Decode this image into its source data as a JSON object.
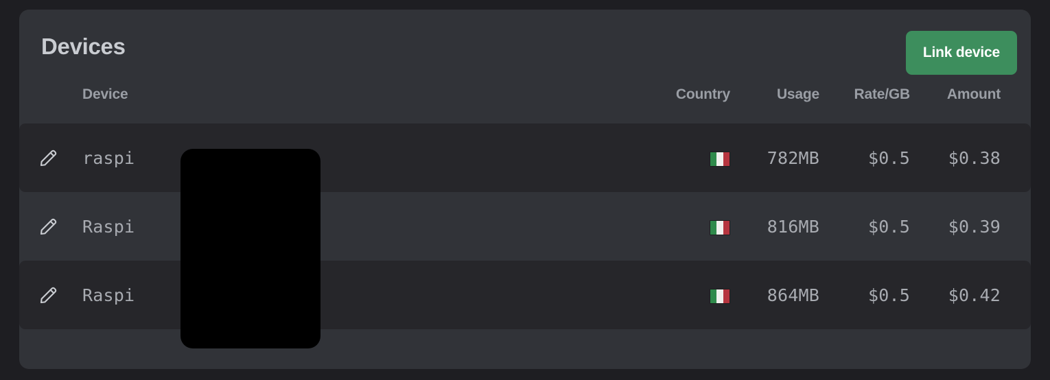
{
  "card": {
    "title": "Devices",
    "primary_action": {
      "label": "Link device",
      "color": "#3d8e5d",
      "text_color": "#ffffff"
    }
  },
  "table": {
    "columns": [
      {
        "key": "edit",
        "label": "",
        "icon": "pencil-icon"
      },
      {
        "key": "device",
        "label": "Device"
      },
      {
        "key": "country",
        "label": "Country"
      },
      {
        "key": "usage",
        "label": "Usage"
      },
      {
        "key": "rate",
        "label": "Rate/GB"
      },
      {
        "key": "amount",
        "label": "Amount"
      }
    ],
    "rows": [
      {
        "edit_icon": "pencil-icon",
        "device": "raspi",
        "country_flag": "flag-italy",
        "country_code": "IT",
        "usage": "782MB",
        "rate": "$0.5",
        "amount": "$0.38"
      },
      {
        "edit_icon": "pencil-icon",
        "device": "Raspi",
        "country_flag": "flag-italy",
        "country_code": "IT",
        "usage": "816MB",
        "rate": "$0.5",
        "amount": "$0.39"
      },
      {
        "edit_icon": "pencil-icon",
        "device": "Raspi",
        "country_flag": "flag-italy",
        "country_code": "IT",
        "usage": "864MB",
        "rate": "$0.5",
        "amount": "$0.42"
      }
    ]
  },
  "overlay": {
    "redaction": {
      "label": "",
      "color": "#000000"
    }
  },
  "theme": {
    "page_background": "#1e1e22",
    "card_background": "#313338",
    "row_alt_background": "#26262a",
    "text_primary": "#c9ccd1",
    "text_secondary": "#9a9ea5",
    "text_mono": "#a8abb1",
    "accent": "#3d8e5d"
  }
}
